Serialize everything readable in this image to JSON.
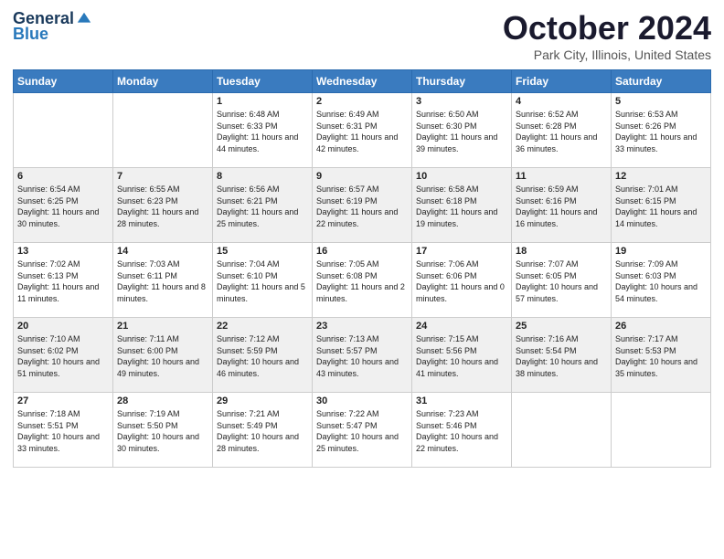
{
  "logo": {
    "general": "General",
    "blue": "Blue"
  },
  "header": {
    "month": "October 2024",
    "location": "Park City, Illinois, United States"
  },
  "days_of_week": [
    "Sunday",
    "Monday",
    "Tuesday",
    "Wednesday",
    "Thursday",
    "Friday",
    "Saturday"
  ],
  "weeks": [
    [
      {
        "day": "",
        "info": ""
      },
      {
        "day": "",
        "info": ""
      },
      {
        "day": "1",
        "info": "Sunrise: 6:48 AM\nSunset: 6:33 PM\nDaylight: 11 hours and 44 minutes."
      },
      {
        "day": "2",
        "info": "Sunrise: 6:49 AM\nSunset: 6:31 PM\nDaylight: 11 hours and 42 minutes."
      },
      {
        "day": "3",
        "info": "Sunrise: 6:50 AM\nSunset: 6:30 PM\nDaylight: 11 hours and 39 minutes."
      },
      {
        "day": "4",
        "info": "Sunrise: 6:52 AM\nSunset: 6:28 PM\nDaylight: 11 hours and 36 minutes."
      },
      {
        "day": "5",
        "info": "Sunrise: 6:53 AM\nSunset: 6:26 PM\nDaylight: 11 hours and 33 minutes."
      }
    ],
    [
      {
        "day": "6",
        "info": "Sunrise: 6:54 AM\nSunset: 6:25 PM\nDaylight: 11 hours and 30 minutes."
      },
      {
        "day": "7",
        "info": "Sunrise: 6:55 AM\nSunset: 6:23 PM\nDaylight: 11 hours and 28 minutes."
      },
      {
        "day": "8",
        "info": "Sunrise: 6:56 AM\nSunset: 6:21 PM\nDaylight: 11 hours and 25 minutes."
      },
      {
        "day": "9",
        "info": "Sunrise: 6:57 AM\nSunset: 6:19 PM\nDaylight: 11 hours and 22 minutes."
      },
      {
        "day": "10",
        "info": "Sunrise: 6:58 AM\nSunset: 6:18 PM\nDaylight: 11 hours and 19 minutes."
      },
      {
        "day": "11",
        "info": "Sunrise: 6:59 AM\nSunset: 6:16 PM\nDaylight: 11 hours and 16 minutes."
      },
      {
        "day": "12",
        "info": "Sunrise: 7:01 AM\nSunset: 6:15 PM\nDaylight: 11 hours and 14 minutes."
      }
    ],
    [
      {
        "day": "13",
        "info": "Sunrise: 7:02 AM\nSunset: 6:13 PM\nDaylight: 11 hours and 11 minutes."
      },
      {
        "day": "14",
        "info": "Sunrise: 7:03 AM\nSunset: 6:11 PM\nDaylight: 11 hours and 8 minutes."
      },
      {
        "day": "15",
        "info": "Sunrise: 7:04 AM\nSunset: 6:10 PM\nDaylight: 11 hours and 5 minutes."
      },
      {
        "day": "16",
        "info": "Sunrise: 7:05 AM\nSunset: 6:08 PM\nDaylight: 11 hours and 2 minutes."
      },
      {
        "day": "17",
        "info": "Sunrise: 7:06 AM\nSunset: 6:06 PM\nDaylight: 11 hours and 0 minutes."
      },
      {
        "day": "18",
        "info": "Sunrise: 7:07 AM\nSunset: 6:05 PM\nDaylight: 10 hours and 57 minutes."
      },
      {
        "day": "19",
        "info": "Sunrise: 7:09 AM\nSunset: 6:03 PM\nDaylight: 10 hours and 54 minutes."
      }
    ],
    [
      {
        "day": "20",
        "info": "Sunrise: 7:10 AM\nSunset: 6:02 PM\nDaylight: 10 hours and 51 minutes."
      },
      {
        "day": "21",
        "info": "Sunrise: 7:11 AM\nSunset: 6:00 PM\nDaylight: 10 hours and 49 minutes."
      },
      {
        "day": "22",
        "info": "Sunrise: 7:12 AM\nSunset: 5:59 PM\nDaylight: 10 hours and 46 minutes."
      },
      {
        "day": "23",
        "info": "Sunrise: 7:13 AM\nSunset: 5:57 PM\nDaylight: 10 hours and 43 minutes."
      },
      {
        "day": "24",
        "info": "Sunrise: 7:15 AM\nSunset: 5:56 PM\nDaylight: 10 hours and 41 minutes."
      },
      {
        "day": "25",
        "info": "Sunrise: 7:16 AM\nSunset: 5:54 PM\nDaylight: 10 hours and 38 minutes."
      },
      {
        "day": "26",
        "info": "Sunrise: 7:17 AM\nSunset: 5:53 PM\nDaylight: 10 hours and 35 minutes."
      }
    ],
    [
      {
        "day": "27",
        "info": "Sunrise: 7:18 AM\nSunset: 5:51 PM\nDaylight: 10 hours and 33 minutes."
      },
      {
        "day": "28",
        "info": "Sunrise: 7:19 AM\nSunset: 5:50 PM\nDaylight: 10 hours and 30 minutes."
      },
      {
        "day": "29",
        "info": "Sunrise: 7:21 AM\nSunset: 5:49 PM\nDaylight: 10 hours and 28 minutes."
      },
      {
        "day": "30",
        "info": "Sunrise: 7:22 AM\nSunset: 5:47 PM\nDaylight: 10 hours and 25 minutes."
      },
      {
        "day": "31",
        "info": "Sunrise: 7:23 AM\nSunset: 5:46 PM\nDaylight: 10 hours and 22 minutes."
      },
      {
        "day": "",
        "info": ""
      },
      {
        "day": "",
        "info": ""
      }
    ]
  ]
}
